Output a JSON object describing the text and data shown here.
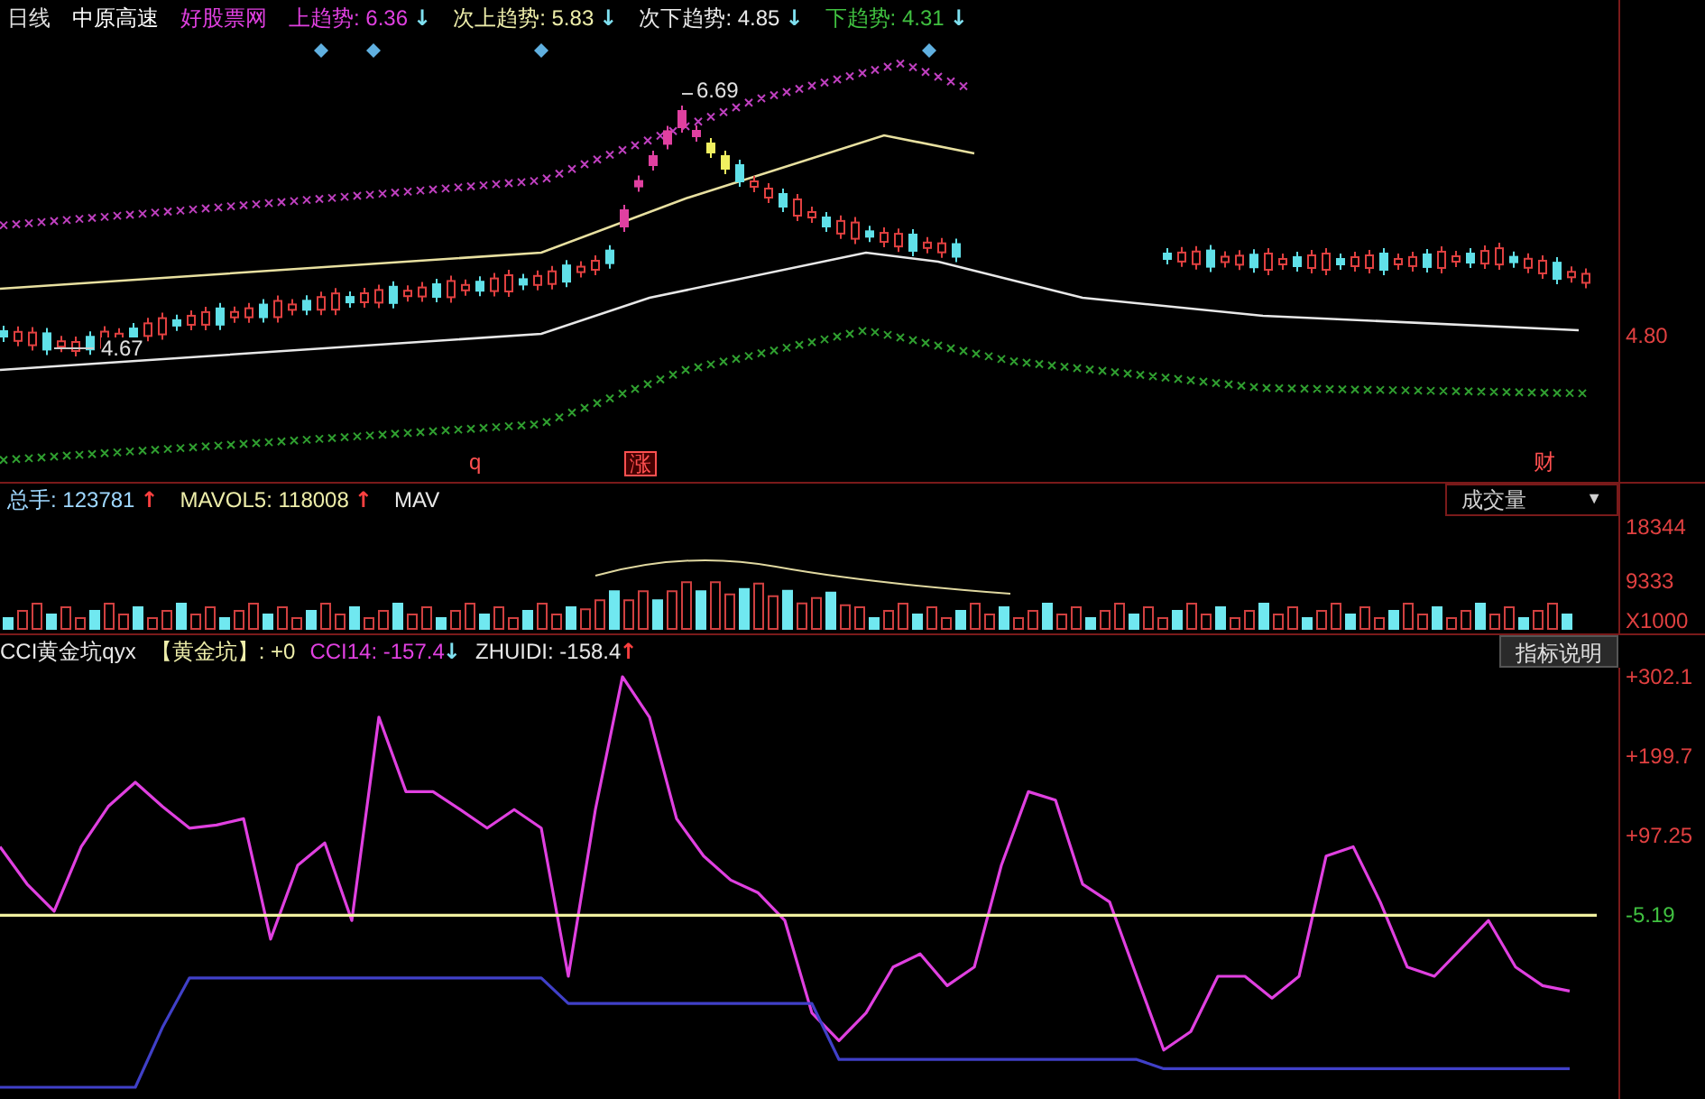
{
  "top_panel": {
    "legend": [
      {
        "text": "日线",
        "color": "#e0e0e0"
      },
      {
        "text": "中原高速",
        "color": "#ffffff"
      },
      {
        "text": "好股票网",
        "color": "#e040e0"
      },
      {
        "text": "上趋势: 6.36",
        "color": "#e040e0",
        "arrow": {
          "text": "↓",
          "color": "#7fe0f0"
        }
      },
      {
        "text": "次上趋势: 5.83",
        "color": "#eeeeaa",
        "arrow": {
          "text": "↓",
          "color": "#7fe0f0"
        }
      },
      {
        "text": "次下趋势: 4.85",
        "color": "#e8e8e8",
        "arrow": {
          "text": "↓",
          "color": "#7fe0f0"
        }
      },
      {
        "text": "下趋势: 4.31",
        "color": "#40c040",
        "arrow": {
          "text": "↓",
          "color": "#7fe0f0"
        }
      }
    ],
    "price_labels": [
      "6.69",
      "4.67"
    ],
    "markers": [
      {
        "text": "q",
        "boxed": false
      },
      {
        "text": "涨",
        "boxed": true
      },
      {
        "text": "财",
        "boxed": false
      }
    ],
    "axis": [
      "4.80"
    ]
  },
  "volume_panel": {
    "legend": [
      {
        "text": "总手: 123781",
        "color": "#9fd8ff",
        "arrow": {
          "text": "↑",
          "color": "#ff4040"
        }
      },
      {
        "text": "MAVOL5: 118008",
        "color": "#eeeeaa",
        "arrow": {
          "text": "↑",
          "color": "#ff4040"
        }
      },
      {
        "text": "MAV",
        "color": "#e8e8e8"
      }
    ],
    "indicator_dropdown": {
      "value": "成交量",
      "caret": "▼"
    },
    "axis": [
      "18344",
      "9333",
      "X1000"
    ]
  },
  "cci_panel": {
    "legend": [
      {
        "text": "CCI黄金坑qyx",
        "color": "#e8e8e8"
      },
      {
        "text": "【黄金坑】: +0",
        "color": "#eeeeaa"
      },
      {
        "text": "CCI14: -157.4",
        "color": "#e040e0",
        "arrow": {
          "text": "↓",
          "color": "#7fe0f0"
        }
      },
      {
        "text": "ZHUIDI: -158.4",
        "color": "#e8e8e8",
        "arrow": {
          "text": "↑",
          "color": "#ff4040"
        }
      }
    ],
    "explain_button": "指标说明",
    "chart_data": {
      "type": "line",
      "ylim": [
        -242,
        313.7
      ],
      "yticks": [
        {
          "value": 302.1,
          "label": "+302.1"
        },
        {
          "value": 199.7,
          "label": "+199.7"
        },
        {
          "value": 97.25,
          "label": "+97.25"
        },
        {
          "value": -5.19,
          "label": "-5.19"
        }
      ],
      "series": [
        {
          "color": "#e040e0",
          "values": [
            83,
            35,
            0,
            83,
            135,
            166,
            135,
            107,
            111,
            119,
            -36,
            59,
            88,
            -12,
            250,
            154,
            154,
            131,
            107,
            131,
            107,
            -84,
            131,
            302,
            250,
            119,
            71,
            40,
            24,
            -12,
            -131,
            -167,
            -131,
            -72,
            -55,
            -96,
            -72,
            59,
            154,
            143,
            35,
            12,
            -84,
            -179,
            -155,
            -84,
            -84,
            -112,
            -84,
            71,
            83,
            12,
            -72,
            -84,
            -48,
            -12,
            -72,
            -96,
            -103
          ]
        },
        {
          "color": "#4040c8",
          "values": [
            -227,
            -227,
            -227,
            -227,
            -227,
            -227,
            -150,
            -86,
            -86,
            -86,
            -86,
            -86,
            -86,
            -86,
            -86,
            -86,
            -86,
            -86,
            -86,
            -86,
            -86,
            -119,
            -119,
            -119,
            -119,
            -119,
            -119,
            -119,
            -119,
            -119,
            -119,
            -191,
            -191,
            -191,
            -191,
            -191,
            -191,
            -191,
            -191,
            -191,
            -191,
            -191,
            -191,
            -203,
            -203,
            -203,
            -203,
            -203,
            -203,
            -203,
            -203,
            -203,
            -203,
            -203,
            -203,
            -203,
            -203,
            -203,
            -203
          ]
        },
        {
          "color": "#f0f0a0",
          "values": [
            -5.19,
            -5.19,
            -5.19,
            -5.19,
            -5.19,
            -5.19,
            -5.19,
            -5.19,
            -5.19,
            -5.19,
            -5.19,
            -5.19,
            -5.19,
            -5.19,
            -5.19,
            -5.19,
            -5.19,
            -5.19,
            -5.19,
            -5.19,
            -5.19,
            -5.19,
            -5.19,
            -5.19,
            -5.19,
            -5.19,
            -5.19,
            -5.19,
            -5.19,
            -5.19,
            -5.19,
            -5.19,
            -5.19,
            -5.19,
            -5.19,
            -5.19,
            -5.19,
            -5.19,
            -5.19,
            -5.19,
            -5.19,
            -5.19,
            -5.19,
            -5.19,
            -5.19,
            -5.19,
            -5.19,
            -5.19,
            -5.19,
            -5.19,
            -5.19,
            -5.19,
            -5.19,
            -5.19,
            -5.19,
            -5.19,
            -5.19,
            -5.19,
            -5.19,
            -5.19
          ]
        }
      ]
    }
  }
}
